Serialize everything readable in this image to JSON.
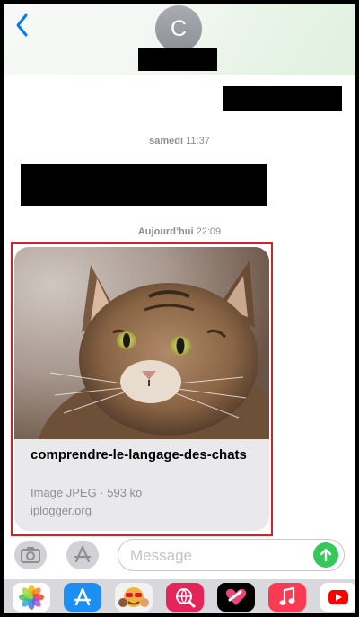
{
  "header": {
    "contact_initial": "C"
  },
  "timestamps": [
    {
      "day": "samedi",
      "time": "11:37"
    },
    {
      "day": "Aujourd’hui",
      "time": "22:09"
    }
  ],
  "link_preview": {
    "title": "comprendre-le-langage-des-chats",
    "meta": "Image JPEG · 593 ko",
    "domain": "iplogger.org"
  },
  "input_bar": {
    "placeholder": "Message"
  },
  "colors": {
    "ios_blue": "#007aff",
    "send_green": "#34c759",
    "highlight_red": "#d81f26"
  },
  "app_strip": [
    "photos-app-icon",
    "app-store-icon",
    "memoji-app-icon",
    "web-search-app-icon",
    "digital-touch-app-icon",
    "music-app-icon",
    "youtube-app-icon"
  ]
}
